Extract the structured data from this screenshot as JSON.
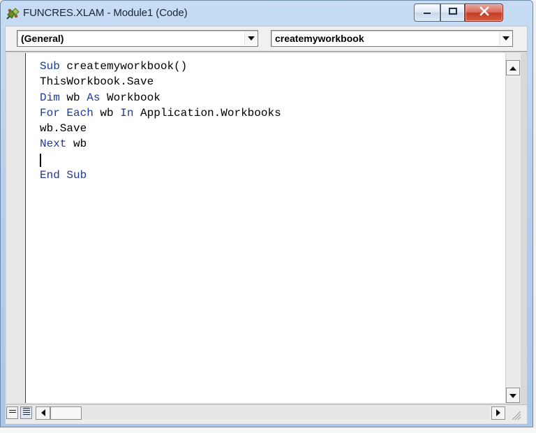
{
  "window": {
    "title": "FUNCRES.XLAM - Module1 (Code)",
    "app_icon": "vba-project-icon",
    "controls": {
      "minimize_icon": "minimize-icon",
      "maximize_icon": "maximize-icon",
      "close_icon": "close-icon"
    }
  },
  "toolbar": {
    "object_selector": {
      "value": "(General)",
      "icon": "chevron-down-icon"
    },
    "procedure_selector": {
      "value": "createmyworkbook",
      "icon": "chevron-down-icon"
    }
  },
  "editor": {
    "line1_keyword": "Sub",
    "line1_text": " createmyworkbook()",
    "line2_text": "ThisWorkbook.Save",
    "line3_kw1": "Dim",
    "line3_text1": " wb ",
    "line3_kw2": "As",
    "line3_text2": " Workbook",
    "line4_kw1": "For",
    "line4_space1": " ",
    "line4_kw2": "Each",
    "line4_text1": " wb ",
    "line4_kw3": "In",
    "line4_text2": " Application.Workbooks",
    "line5_text": "wb.Save",
    "line6_keyword": "Next",
    "line6_text": " wb",
    "line8_keyword": "End Sub",
    "colors": {
      "keyword": "#1f3a93",
      "text": "#000000",
      "background": "#ffffff"
    }
  },
  "status": {
    "procedure_view_icon": "procedure-view-icon",
    "module_view_icon": "full-module-view-icon",
    "scroll_left_icon": "left-arrow-icon",
    "scroll_right_icon": "right-arrow-icon",
    "scroll_up_icon": "up-arrow-icon",
    "scroll_down_icon": "down-arrow-icon",
    "size_grip_icon": "size-grip-icon"
  }
}
